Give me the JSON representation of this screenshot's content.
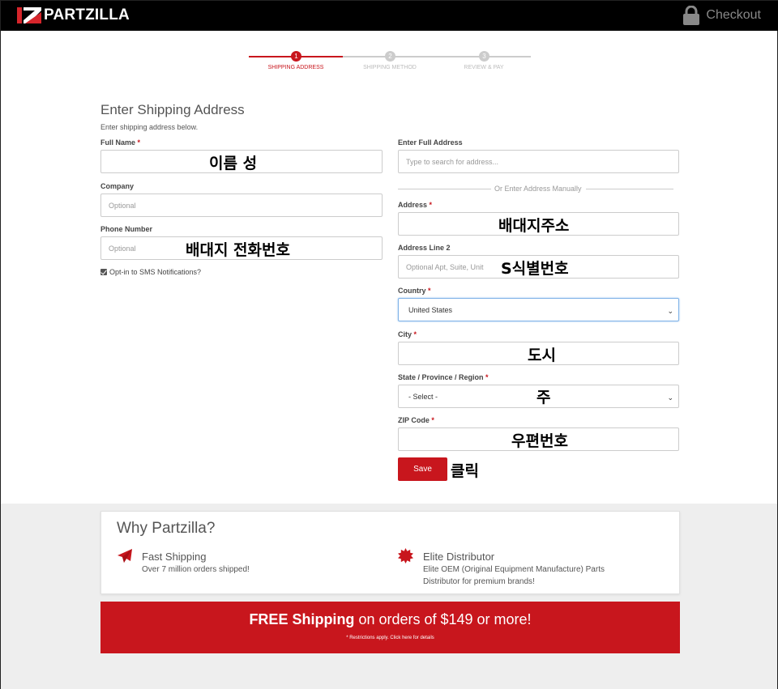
{
  "header": {
    "logo_text": "PARTZILLA",
    "checkout_label": "Checkout"
  },
  "steps": [
    {
      "number": "1",
      "label": "SHIPPING ADDRESS",
      "active": true
    },
    {
      "number": "2",
      "label": "SHIPPING METHOD",
      "active": false
    },
    {
      "number": "3",
      "label": "REVIEW & PAY",
      "active": false
    }
  ],
  "form": {
    "title": "Enter Shipping Address",
    "subtitle": "Enter shipping address below.",
    "required_mark": "*",
    "full_name": {
      "label": "Full Name",
      "value": "",
      "annotation": "이름 성"
    },
    "company": {
      "label": "Company",
      "placeholder": "Optional"
    },
    "phone": {
      "label": "Phone Number",
      "placeholder": "Optional",
      "annotation": "배대지 전화번호"
    },
    "sms_opt_in": {
      "label": "Opt-in to SMS Notifications?",
      "checked": true
    },
    "full_address": {
      "label": "Enter Full Address",
      "placeholder": "Type to search for address..."
    },
    "manual_divider": "Or Enter Address Manually",
    "address": {
      "label": "Address",
      "value": "",
      "annotation": "배대지주소"
    },
    "address2": {
      "label": "Address Line 2",
      "placeholder": "Optional Apt, Suite, Unit",
      "annotation": "S식별번호"
    },
    "country": {
      "label": "Country",
      "value": "United States"
    },
    "city": {
      "label": "City",
      "value": "",
      "annotation": "도시"
    },
    "state": {
      "label": "State / Province / Region",
      "value": "- Select -",
      "annotation": "주"
    },
    "zip": {
      "label": "ZIP Code",
      "value": "",
      "annotation": "우편번호"
    },
    "save_label": "Save",
    "save_annotation": "클릭"
  },
  "why": {
    "title": "Why Partzilla?",
    "features": [
      {
        "icon": "paper-plane-icon",
        "title": "Fast Shipping",
        "desc": "Over 7 million orders shipped!"
      },
      {
        "icon": "badge-seal-icon",
        "title": "Elite Distributor",
        "desc_line1": "Elite OEM (Original Equipment Manufacture) Parts",
        "desc_line2": "Distributor for premium brands!"
      }
    ]
  },
  "banner": {
    "bold": "FREE Shipping",
    "rest": " on orders of $149 or more!",
    "note": "* Restrictions apply. Click here for details"
  },
  "colors": {
    "brand_red": "#c8161d",
    "header_bg": "#000000",
    "footer_bg": "#eeeeee"
  }
}
